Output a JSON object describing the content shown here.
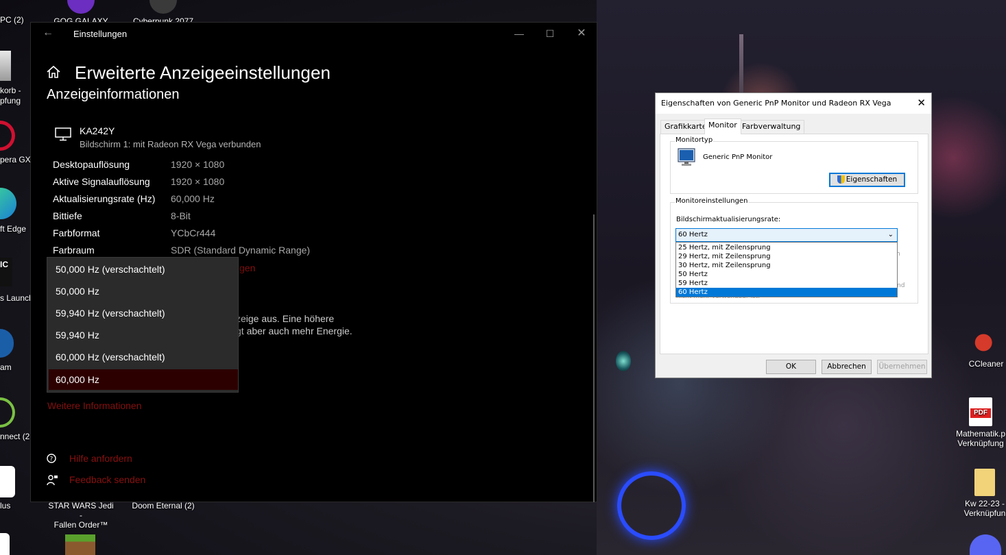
{
  "desktop": {
    "icons_top": [
      {
        "label": "GOG GALAXY"
      },
      {
        "label": "Cyberpunk 2077"
      }
    ],
    "left_labels": [
      "PC (2)",
      "korb -",
      "pfung",
      "pera GX (",
      "ft Edge",
      "IC",
      "s Launch",
      "am",
      "nnect (2",
      "lus"
    ],
    "bottom_icons": [
      {
        "label_1": "STAR WARS Jedi -",
        "label_2": "Fallen Order™"
      },
      {
        "label_1": "Doom Eternal (2)",
        "label_2": ""
      }
    ],
    "right_icons": [
      {
        "label_1": "CCleaner",
        "label_2": ""
      },
      {
        "label_1": "Mathematik.p",
        "label_2": "Verknüpfung",
        "badge": "PDF"
      },
      {
        "label_1": "Kw 22-23 -",
        "label_2": "Verknüpfun"
      }
    ]
  },
  "settings": {
    "window_title": "Einstellungen",
    "page_title": "Erweiterte Anzeigeeinstellungen",
    "section_title": "Anzeigeinformationen",
    "monitor_name": "KA242Y",
    "monitor_subtitle": "Bildschirm 1: mit Radeon RX Vega verbunden",
    "info_rows": [
      {
        "key": "Desktopauflösung",
        "value": "1920 × 1080"
      },
      {
        "key": "Aktive Signalauflösung",
        "value": "1920 × 1080"
      },
      {
        "key": "Aktualisierungsrate (Hz)",
        "value": "60,000 Hz"
      },
      {
        "key": "Bittiefe",
        "value": "8-Bit"
      },
      {
        "key": "Farbformat",
        "value": "YCbCr444"
      },
      {
        "key": "Farbraum",
        "value": "SDR (Standard Dynamic Range)"
      }
    ],
    "link_partial": "gen",
    "description_line1": "zeige aus. Eine höhere",
    "description_line2": "gt aber auch mehr Energie.",
    "refresh_options": [
      "50,000 Hz (verschachtelt)",
      "50,000 Hz",
      "59,940 Hz (verschachtelt)",
      "59,940 Hz",
      "60,000 Hz (verschachtelt)",
      "60,000 Hz"
    ],
    "selected_option": "60,000 Hz",
    "more_info_link": "Weitere Informationen",
    "help_link": "Hilfe anfordern",
    "feedback_link": "Feedback senden"
  },
  "dialog": {
    "title": "Eigenschaften von Generic PnP Monitor und Radeon RX Vega",
    "tabs": [
      "Grafikkarte",
      "Monitor",
      "Farbverwaltung"
    ],
    "active_tab": "Monitor",
    "group_monitor_type": "Monitortyp",
    "monitor_type_name": "Generic PnP Monitor",
    "properties_button": "Eigenschaften",
    "group_monitor_settings": "Monitoreinstellungen",
    "refresh_label": "Bildschirmaktualisierungsrate:",
    "refresh_selected": "60 Hertz",
    "refresh_options": [
      "25 Hertz, mit Zeilensprung",
      "29 Hertz, mit Zeilensprung",
      "30 Hertz, mit Zeilensprung",
      "50 Hertz",
      "59 Hertz",
      "60 Hertz"
    ],
    "obscured_text": "nicht mehr verwendbar ist.",
    "obscured_tail": "nd",
    "ok_button": "OK",
    "cancel_button": "Abbrechen",
    "apply_button": "Übernehmen"
  },
  "colors": {
    "accent_red": "#8a1010",
    "selection_dark_red": "#2d0000",
    "win_blue": "#0078d7"
  }
}
